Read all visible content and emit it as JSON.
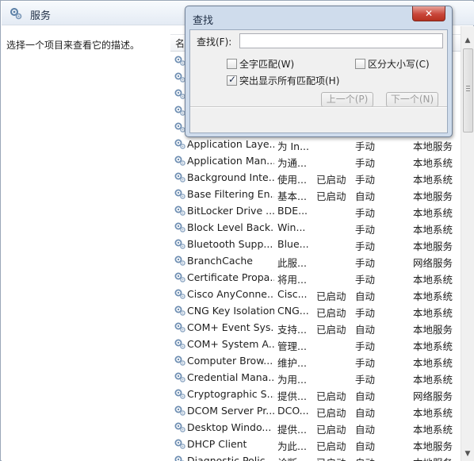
{
  "window": {
    "title": "服务",
    "icon": "services-gear-icon"
  },
  "description_pane": {
    "text": "选择一个项目来查看它的描述。"
  },
  "list": {
    "columns": [
      "名",
      "",
      "",
      "",
      ""
    ],
    "rows": [
      {
        "name": "",
        "desc": "",
        "status": "",
        "startup": "",
        "logon": ""
      },
      {
        "name": "",
        "desc": "",
        "status": "",
        "startup": "",
        "logon": ""
      },
      {
        "name": "",
        "desc": "",
        "status": "",
        "startup": "",
        "logon": ""
      },
      {
        "name": "",
        "desc": "",
        "status": "",
        "startup": "",
        "logon": ""
      },
      {
        "name": "",
        "desc": "",
        "status": "",
        "startup": "",
        "logon": ""
      },
      {
        "name": "Application Laye...",
        "desc": "为 In...",
        "status": "",
        "startup": "手动",
        "logon": "本地服务"
      },
      {
        "name": "Application Man...",
        "desc": "为通...",
        "status": "",
        "startup": "手动",
        "logon": "本地系统"
      },
      {
        "name": "Background Inte...",
        "desc": "使用...",
        "status": "已启动",
        "startup": "手动",
        "logon": "本地系统"
      },
      {
        "name": "Base Filtering En...",
        "desc": "基本...",
        "status": "已启动",
        "startup": "自动",
        "logon": "本地服务"
      },
      {
        "name": "BitLocker Drive ...",
        "desc": "BDE...",
        "status": "",
        "startup": "手动",
        "logon": "本地系统"
      },
      {
        "name": "Block Level Back...",
        "desc": "Win...",
        "status": "",
        "startup": "手动",
        "logon": "本地系统"
      },
      {
        "name": "Bluetooth Supp...",
        "desc": "Blue...",
        "status": "",
        "startup": "手动",
        "logon": "本地服务"
      },
      {
        "name": "BranchCache",
        "desc": "此服...",
        "status": "",
        "startup": "手动",
        "logon": "网络服务"
      },
      {
        "name": "Certificate Propa...",
        "desc": "将用...",
        "status": "",
        "startup": "手动",
        "logon": "本地系统"
      },
      {
        "name": "Cisco AnyConne...",
        "desc": "Cisc...",
        "status": "已启动",
        "startup": "自动",
        "logon": "本地系统"
      },
      {
        "name": "CNG Key Isolation",
        "desc": "CNG...",
        "status": "已启动",
        "startup": "手动",
        "logon": "本地系统"
      },
      {
        "name": "COM+ Event Sys...",
        "desc": "支持...",
        "status": "已启动",
        "startup": "自动",
        "logon": "本地服务"
      },
      {
        "name": "COM+ System A...",
        "desc": "管理...",
        "status": "",
        "startup": "手动",
        "logon": "本地系统"
      },
      {
        "name": "Computer Brow...",
        "desc": "维护...",
        "status": "",
        "startup": "手动",
        "logon": "本地系统"
      },
      {
        "name": "Credential Mana...",
        "desc": "为用...",
        "status": "",
        "startup": "手动",
        "logon": "本地系统"
      },
      {
        "name": "Cryptographic S...",
        "desc": "提供...",
        "status": "已启动",
        "startup": "自动",
        "logon": "网络服务"
      },
      {
        "name": "DCOM Server Pr...",
        "desc": "DCO...",
        "status": "已启动",
        "startup": "自动",
        "logon": "本地系统"
      },
      {
        "name": "Desktop Windo...",
        "desc": "提供...",
        "status": "已启动",
        "startup": "自动",
        "logon": "本地系统"
      },
      {
        "name": "DHCP Client",
        "desc": "为此...",
        "status": "已启动",
        "startup": "自动",
        "logon": "本地服务"
      },
      {
        "name": "Diagnostic Polic...",
        "desc": "诊断...",
        "status": "已启动",
        "startup": "自动",
        "logon": "本地服务"
      }
    ]
  },
  "find_dialog": {
    "title": "查找",
    "close_label": "✕",
    "find_label": "查找(F):",
    "find_value": "",
    "whole_word_label": "全字匹配(W)",
    "match_case_label": "区分大小写(C)",
    "highlight_all_label": "突出显示所有匹配项(H)",
    "prev_button": "上一个(P)",
    "next_button": "下一个(N)",
    "whole_word_checked": false,
    "match_case_checked": false,
    "highlight_all_checked": true
  }
}
